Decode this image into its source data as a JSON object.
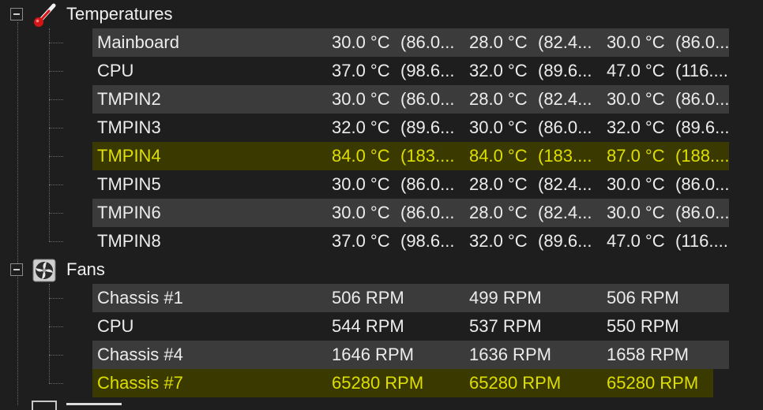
{
  "groups": [
    {
      "label": "Temperatures",
      "icon": "thermometer-icon",
      "rows": [
        {
          "name": "Mainboard",
          "v1": "30.0 °C",
          "f1": "(86.0...",
          "v2": "28.0 °C",
          "f2": "(82.4...",
          "v3": "30.0 °C",
          "f3": "(86.0..."
        },
        {
          "name": "CPU",
          "v1": "37.0 °C",
          "f1": "(98.6...",
          "v2": "32.0 °C",
          "f2": "(89.6...",
          "v3": "47.0 °C",
          "f3": "(116...."
        },
        {
          "name": "TMPIN2",
          "v1": "30.0 °C",
          "f1": "(86.0...",
          "v2": "28.0 °C",
          "f2": "(82.4...",
          "v3": "30.0 °C",
          "f3": "(86.0..."
        },
        {
          "name": "TMPIN3",
          "v1": "32.0 °C",
          "f1": "(89.6...",
          "v2": "30.0 °C",
          "f2": "(86.0...",
          "v3": "32.0 °C",
          "f3": "(89.6..."
        },
        {
          "name": "TMPIN4",
          "v1": "84.0 °C",
          "f1": "(183....",
          "v2": "84.0 °C",
          "f2": "(183....",
          "v3": "87.0 °C",
          "f3": "(188...."
        },
        {
          "name": "TMPIN5",
          "v1": "30.0 °C",
          "f1": "(86.0...",
          "v2": "28.0 °C",
          "f2": "(82.4...",
          "v3": "30.0 °C",
          "f3": "(86.0..."
        },
        {
          "name": "TMPIN6",
          "v1": "30.0 °C",
          "f1": "(86.0...",
          "v2": "28.0 °C",
          "f2": "(82.4...",
          "v3": "30.0 °C",
          "f3": "(86.0..."
        },
        {
          "name": "TMPIN8",
          "v1": "37.0 °C",
          "f1": "(98.6...",
          "v2": "32.0 °C",
          "f2": "(89.6...",
          "v3": "47.0 °C",
          "f3": "(116...."
        }
      ]
    },
    {
      "label": "Fans",
      "icon": "fan-icon",
      "rows": [
        {
          "name": "Chassis #1",
          "v1": "506 RPM",
          "v2": "499 RPM",
          "v3": "506 RPM"
        },
        {
          "name": "CPU",
          "v1": "544 RPM",
          "v2": "537 RPM",
          "v3": "550 RPM"
        },
        {
          "name": "Chassis #4",
          "v1": "1646 RPM",
          "v2": "1636 RPM",
          "v3": "1658 RPM"
        },
        {
          "name": "Chassis #7",
          "v1": "65280 RPM",
          "v2": "65280 RPM",
          "v3": "65280 RPM"
        }
      ]
    }
  ],
  "colors": {
    "background": "#1e1e1e",
    "row_alt": "#3b3b3b",
    "alert_background": "#3a3a00",
    "alert_text": "#dede00",
    "text": "#ececec"
  }
}
